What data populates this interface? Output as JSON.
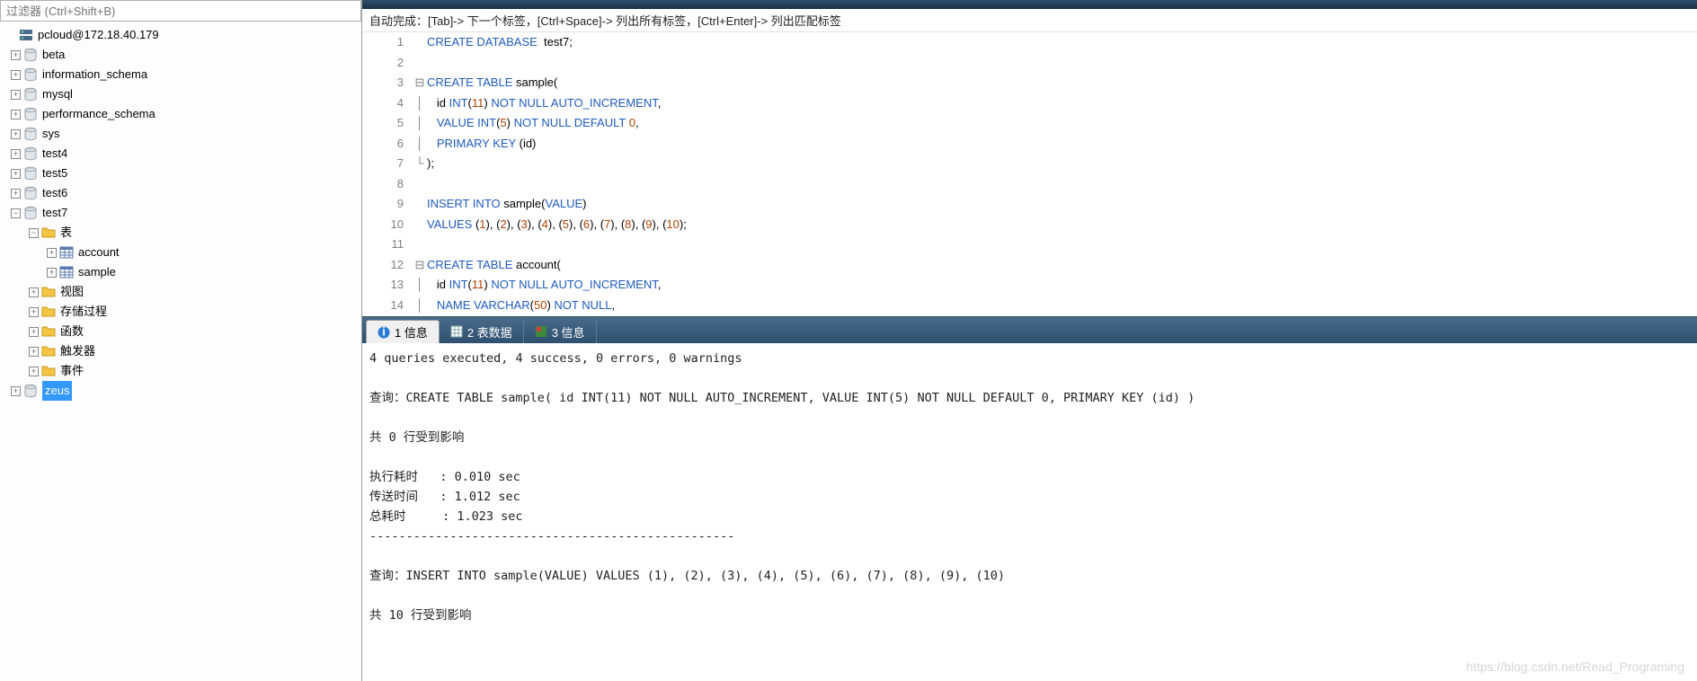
{
  "filter": {
    "placeholder": "过滤器 (Ctrl+Shift+B)"
  },
  "server": {
    "label": "pcloud@172.18.40.179"
  },
  "databases": [
    {
      "name": "beta"
    },
    {
      "name": "information_schema"
    },
    {
      "name": "mysql"
    },
    {
      "name": "performance_schema"
    },
    {
      "name": "sys"
    },
    {
      "name": "test4"
    },
    {
      "name": "test5"
    },
    {
      "name": "test6"
    }
  ],
  "open_db": {
    "name": "test7",
    "folders": {
      "tables": {
        "label": "表",
        "items": [
          "account",
          "sample"
        ]
      },
      "views": {
        "label": "视图"
      },
      "procs": {
        "label": "存储过程"
      },
      "functions": {
        "label": "函数"
      },
      "triggers": {
        "label": "触发器"
      },
      "events": {
        "label": "事件"
      }
    }
  },
  "last_db": {
    "name": "zeus"
  },
  "hint": "自动完成：[Tab]-> 下一个标签，[Ctrl+Space]-> 列出所有标签，[Ctrl+Enter]-> 列出匹配标签",
  "editor": {
    "lines": [
      {
        "n": 1,
        "t": [
          [
            "kw",
            "CREATE DATABASE"
          ],
          [
            "",
            "  test7;"
          ]
        ]
      },
      {
        "n": 2,
        "t": [
          [
            "",
            ""
          ]
        ]
      },
      {
        "n": 3,
        "fold": "-",
        "t": [
          [
            "kw",
            "CREATE TABLE"
          ],
          [
            "",
            " sample("
          ]
        ]
      },
      {
        "n": 4,
        "bar": true,
        "t": [
          [
            "",
            "   id "
          ],
          [
            "kw",
            "INT"
          ],
          [
            "",
            "("
          ],
          [
            "num",
            "11"
          ],
          [
            "",
            ") "
          ],
          [
            "kw",
            "NOT NULL AUTO_INCREMENT"
          ],
          [
            "",
            ","
          ]
        ]
      },
      {
        "n": 5,
        "bar": true,
        "t": [
          [
            "",
            "   "
          ],
          [
            "kw",
            "VALUE INT"
          ],
          [
            "",
            "("
          ],
          [
            "num",
            "5"
          ],
          [
            "",
            ") "
          ],
          [
            "kw",
            "NOT NULL DEFAULT"
          ],
          [
            "",
            " "
          ],
          [
            "num",
            "0"
          ],
          [
            "",
            ","
          ]
        ]
      },
      {
        "n": 6,
        "bar": true,
        "t": [
          [
            "",
            "   "
          ],
          [
            "kw",
            "PRIMARY KEY"
          ],
          [
            "",
            " (id)"
          ]
        ]
      },
      {
        "n": 7,
        "end": true,
        "t": [
          [
            "",
            ");"
          ]
        ]
      },
      {
        "n": 8,
        "t": [
          [
            "",
            ""
          ]
        ]
      },
      {
        "n": 9,
        "t": [
          [
            "kw",
            "INSERT INTO"
          ],
          [
            "",
            " sample("
          ],
          [
            "kw",
            "VALUE"
          ],
          [
            "",
            ")"
          ]
        ]
      },
      {
        "n": 10,
        "t": [
          [
            "kw",
            "VALUES"
          ],
          [
            "",
            " ("
          ],
          [
            "num",
            "1"
          ],
          [
            "",
            "), ("
          ],
          [
            "num",
            "2"
          ],
          [
            "",
            "), ("
          ],
          [
            "num",
            "3"
          ],
          [
            "",
            "), ("
          ],
          [
            "num",
            "4"
          ],
          [
            "",
            "), ("
          ],
          [
            "num",
            "5"
          ],
          [
            "",
            "), ("
          ],
          [
            "num",
            "6"
          ],
          [
            "",
            "), ("
          ],
          [
            "num",
            "7"
          ],
          [
            "",
            "), ("
          ],
          [
            "num",
            "8"
          ],
          [
            "",
            "), ("
          ],
          [
            "num",
            "9"
          ],
          [
            "",
            "), ("
          ],
          [
            "num",
            "10"
          ],
          [
            "",
            ");"
          ]
        ]
      },
      {
        "n": 11,
        "t": [
          [
            "",
            ""
          ]
        ]
      },
      {
        "n": 12,
        "fold": "-",
        "t": [
          [
            "kw",
            "CREATE TABLE"
          ],
          [
            "",
            " account("
          ]
        ]
      },
      {
        "n": 13,
        "bar": true,
        "t": [
          [
            "",
            "   id "
          ],
          [
            "kw",
            "INT"
          ],
          [
            "",
            "("
          ],
          [
            "num",
            "11"
          ],
          [
            "",
            ") "
          ],
          [
            "kw",
            "NOT NULL AUTO_INCREMENT"
          ],
          [
            "",
            ","
          ]
        ]
      },
      {
        "n": 14,
        "bar": true,
        "t": [
          [
            "",
            "   "
          ],
          [
            "kw",
            "NAME VARCHAR"
          ],
          [
            "",
            "("
          ],
          [
            "num",
            "50"
          ],
          [
            "",
            ") "
          ],
          [
            "kw",
            "NOT NULL"
          ],
          [
            "",
            ","
          ]
        ]
      }
    ]
  },
  "tabs": [
    {
      "label": "1 信息",
      "icon": "info",
      "active": true
    },
    {
      "label": "2 表数据",
      "icon": "grid",
      "active": false
    },
    {
      "label": "3 信息",
      "icon": "info2",
      "active": false
    }
  ],
  "result": {
    "summary": "4 queries executed, 4 success, 0 errors, 0 warnings",
    "q1_label": "查询：",
    "q1": "CREATE TABLE sample( id INT(11) NOT NULL AUTO_INCREMENT, VALUE INT(5) NOT NULL DEFAULT 0, PRIMARY KEY (id) )",
    "rows_label": "共 0 行受到影响",
    "exec_label": "执行耗时   : 0.010 sec",
    "trans_label": "传送时间   : 1.012 sec",
    "total_label": "总耗时     : 1.023 sec",
    "sep": "--------------------------------------------------",
    "q2_label": "查询：",
    "q2": "INSERT INTO sample(VALUE) VALUES (1), (2), (3), (4), (5), (6), (7), (8), (9), (10)",
    "tail": "共 10 行受到影响"
  },
  "watermark": "https://blog.csdn.net/Read_Programing"
}
